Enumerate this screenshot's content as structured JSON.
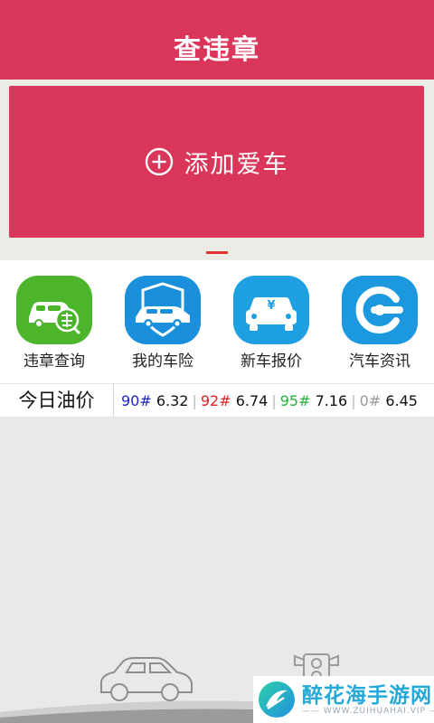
{
  "header": {
    "title": "查违章"
  },
  "banner": {
    "add_car_label": "添加爱车",
    "add_icon": "plus-circle-icon",
    "active_page": 1
  },
  "grid": [
    {
      "label": "违章查询",
      "icon": "violation-car-icon",
      "color": "#4cb52b"
    },
    {
      "label": "我的车险",
      "icon": "car-shield-icon",
      "color": "#1a8fdc"
    },
    {
      "label": "新车报价",
      "icon": "car-price-icon",
      "color": "#1d9fe2"
    },
    {
      "label": "汽车资讯",
      "icon": "news-e-icon",
      "color": "#1b98de"
    }
  ],
  "oil": {
    "title": "今日油价",
    "prices": [
      {
        "grade": "90#",
        "price": "6.32",
        "color": "#1b24c8"
      },
      {
        "grade": "92#",
        "price": "6.74",
        "color": "#e02020"
      },
      {
        "grade": "95#",
        "price": "7.16",
        "color": "#21b33a"
      },
      {
        "grade": "0#",
        "price": "6.45",
        "color": "#9a9a9a"
      }
    ]
  },
  "watermark": {
    "title": "醉花海手游网",
    "subtitle": "—— WWW.ZUIHUAHAI.VIP ——"
  },
  "colors": {
    "brand": "#d9365a",
    "background": "#e9e9e9"
  }
}
